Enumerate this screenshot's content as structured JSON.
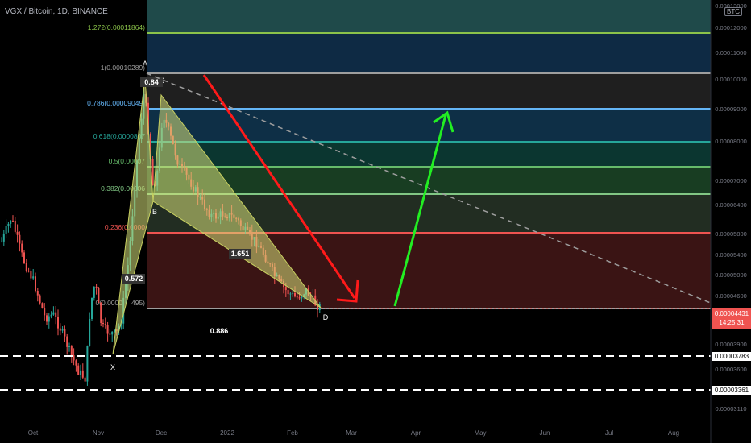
{
  "header": {
    "title": "VGX / Bitcoin, 1D, BINANCE",
    "currency_badge": "BTC"
  },
  "colors": {
    "background": "#000000",
    "up": "#26a69a",
    "down": "#ef5350",
    "pattern_fill": "#d7e07a",
    "arrow_down": "#ff1a1a",
    "arrow_up": "#22ee22",
    "last_price_tag": "#ef5350"
  },
  "chart_data": {
    "type": "candlestick",
    "title": "VGX / Bitcoin, 1D, BINANCE",
    "x_ticks": [
      "Oct",
      "Nov",
      "Dec",
      "2022",
      "Feb",
      "Mar",
      "Apr",
      "May",
      "Jun",
      "Jul",
      "Aug"
    ],
    "y_ticks": [
      "0.00012000",
      "0.00011000",
      "0.00010000",
      "0.00009000",
      "0.00008000",
      "0.00007000",
      "0.00006400",
      "0.00005800",
      "0.00005400",
      "0.00005000",
      "0.00004600",
      "0.00003900",
      "0.00003600",
      "0.00003110"
    ],
    "y_axis_top_partial": "0.00013000",
    "last_price": {
      "price": "0.00004431",
      "countdown": "14:25:31"
    },
    "horizontal_levels": [
      {
        "price": "0.00003783",
        "style": "dashed white"
      },
      {
        "price": "0.00003361",
        "style": "dashed white"
      }
    ],
    "fibonacci": {
      "levels": [
        {
          "ratio": "1.272",
          "label": "1.272(0.00011864)",
          "color": "#8bc34a"
        },
        {
          "ratio": "1",
          "label": "1(0.00010289)",
          "color": "#9e9e9e"
        },
        {
          "ratio": "0.786",
          "label": "0.786(0.00009049)",
          "color": "#64b5f6"
        },
        {
          "ratio": "0.618",
          "label": "0.618(0.0000807",
          "color": "#26a69a"
        },
        {
          "ratio": "0.5",
          "label": "0.5(0.00007",
          "color": "#66bb6a"
        },
        {
          "ratio": "0.382",
          "label": "0.382(0.00006",
          "color": "#81c784"
        },
        {
          "ratio": "0.236",
          "label": "0.236(0.0000",
          "color": "#ef5350"
        },
        {
          "ratio": "0",
          "label": "0(0.0000",
          "label_tail": "495)",
          "color": "#9e9e9e"
        }
      ]
    },
    "harmonic_pattern": {
      "points": [
        "X",
        "A",
        "B",
        "C",
        "D"
      ],
      "ratios": [
        "0.572",
        "0.84",
        "1.651",
        "0.886"
      ]
    }
  }
}
